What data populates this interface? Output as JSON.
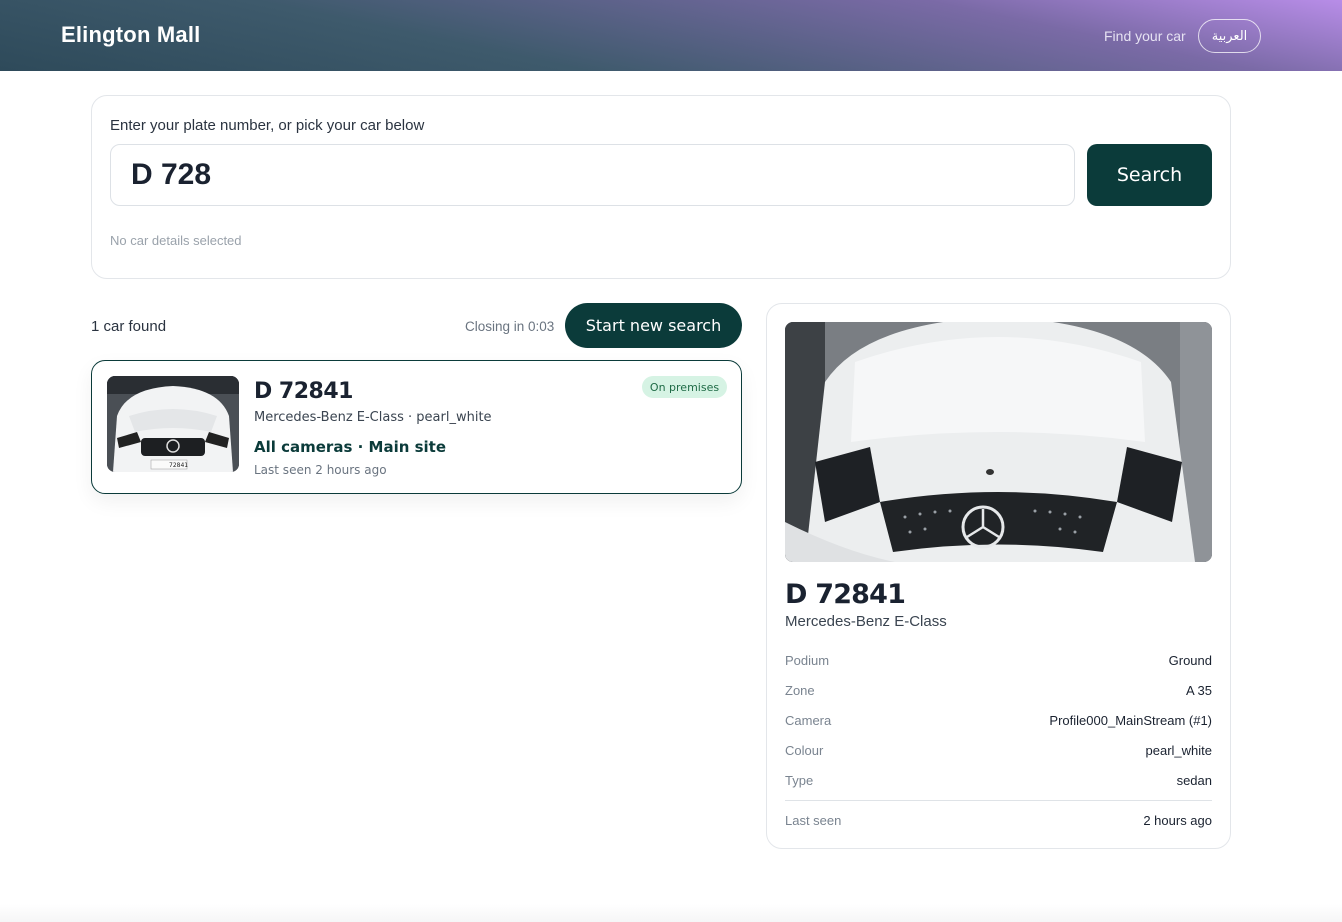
{
  "header": {
    "brand": "Elington Mall",
    "find_link": "Find your car",
    "language_button": "العربية"
  },
  "search": {
    "label": "Enter your plate number, or pick your car below",
    "plate_value": "D 728",
    "button": "Search",
    "selection_status": "No car details selected"
  },
  "results": {
    "count_text": "1 car found",
    "closing_text": "Closing in 0:03",
    "new_search_button": "Start new search",
    "items": [
      {
        "plate": "D 72841",
        "status_badge": "On premises",
        "car_line": "Mercedes-Benz E-Class · pearl_white",
        "camera_line": "All cameras · Main site",
        "last_seen": "Last seen 2 hours ago",
        "thumb_plate_text": "72841"
      }
    ]
  },
  "detail": {
    "plate": "D 72841",
    "model": "Mercedes-Benz E-Class",
    "rows": [
      {
        "key": "Podium",
        "value": "Ground"
      },
      {
        "key": "Zone",
        "value": "A 35"
      },
      {
        "key": "Camera",
        "value": "Profile000_MainStream (#1)"
      },
      {
        "key": "Colour",
        "value": "pearl_white"
      },
      {
        "key": "Type",
        "value": "sedan"
      }
    ],
    "last_seen": {
      "key": "Last seen",
      "value": "2 hours ago"
    }
  },
  "colors": {
    "primary": "#0b3b3a",
    "badge_bg": "#d6f3e4",
    "badge_text": "#1f6b46"
  }
}
